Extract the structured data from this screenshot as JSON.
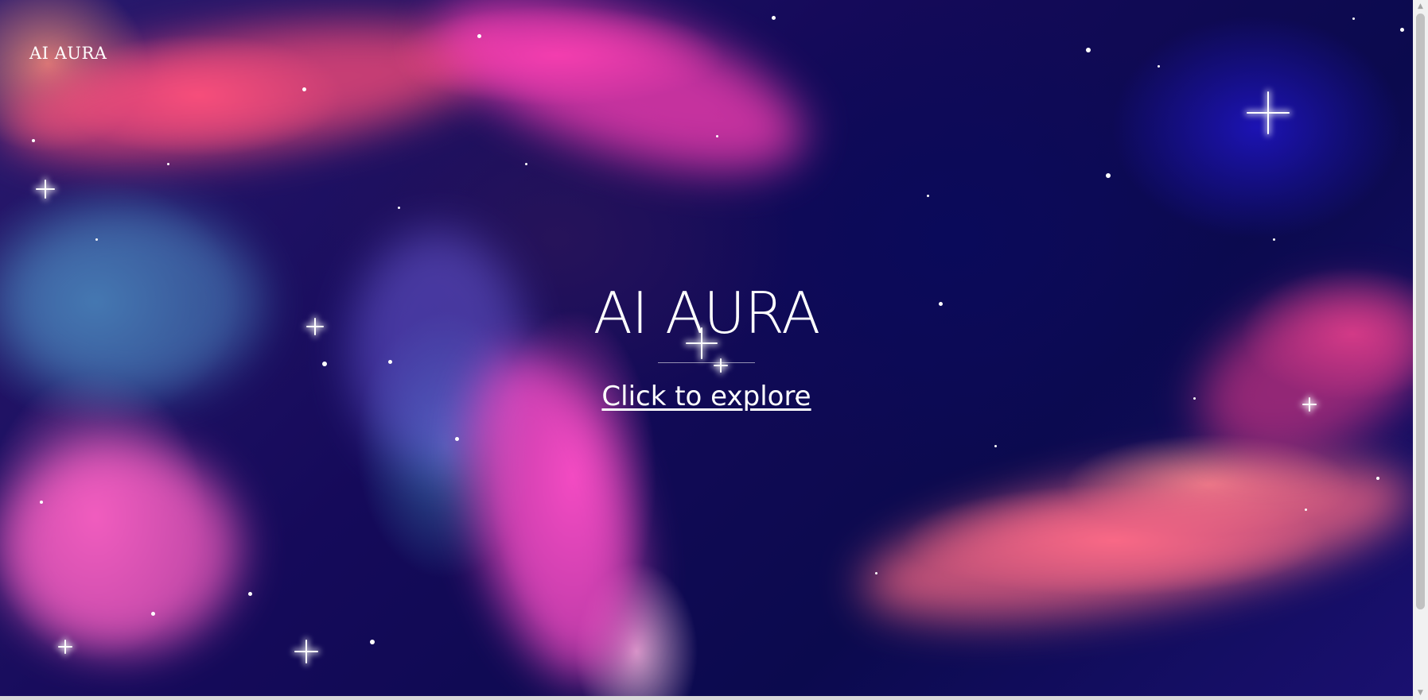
{
  "header": {
    "brand": "AI AURA"
  },
  "hero": {
    "title": "AI AURA",
    "cta": "Click to explore"
  },
  "scrollbar": {
    "up_icon": "▲",
    "down_icon": "▼"
  },
  "colors": {
    "background": "#0b0a4e",
    "text": "#ffffff",
    "accent_pink": "#ff50b4",
    "accent_coral": "#ff6e8c"
  }
}
